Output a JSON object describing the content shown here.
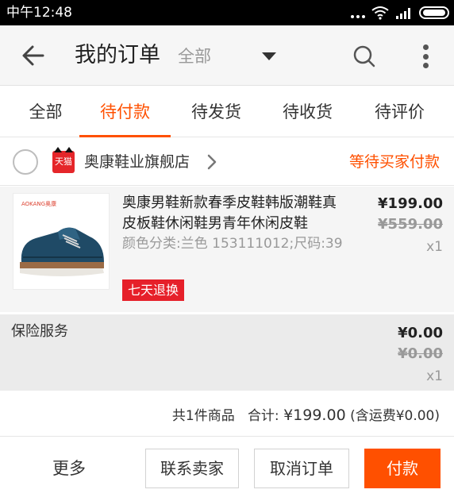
{
  "status_bar": {
    "time": "中午12:48"
  },
  "header": {
    "title": "我的订单",
    "filter_label": "全部"
  },
  "tabs": [
    {
      "label": "全部",
      "active": false
    },
    {
      "label": "待付款",
      "active": true
    },
    {
      "label": "待发货",
      "active": false
    },
    {
      "label": "待收货",
      "active": false
    },
    {
      "label": "待评价",
      "active": false
    }
  ],
  "shop": {
    "badge_text": "天猫",
    "name": "奥康鞋业旗舰店",
    "status": "等待买家付款"
  },
  "product": {
    "brand_logo": "AOKANG奥康",
    "title": "奥康男鞋新款春季皮鞋韩版潮鞋真皮板鞋休闲鞋男青年休闲皮鞋",
    "sku": "颜色分类:兰色 153111012;尺码:39",
    "tag": "七天退换",
    "price": "¥199.00",
    "original_price": "¥559.00",
    "quantity": "x1"
  },
  "insurance": {
    "label": "保险服务",
    "price": "¥0.00",
    "original_price": "¥0.00",
    "quantity": "x1"
  },
  "summary": {
    "item_count": "共1件商品",
    "total_label": "合计:",
    "currency": "¥",
    "amount": "199.00",
    "shipping_note": "(含运费¥0.00)"
  },
  "actions": {
    "more_label": "更多",
    "contact_seller": "联系卖家",
    "cancel_order": "取消订单",
    "pay": "付款"
  },
  "colors": {
    "accent": "#ff5000",
    "tag_red": "#e6202a",
    "tmall_red": "#e5262a"
  },
  "icons": [
    "back-arrow-icon",
    "dropdown-caret-icon",
    "search-icon",
    "more-vertical-icon",
    "chevron-right-icon",
    "wifi-icon",
    "signal-icon",
    "battery-icon"
  ]
}
